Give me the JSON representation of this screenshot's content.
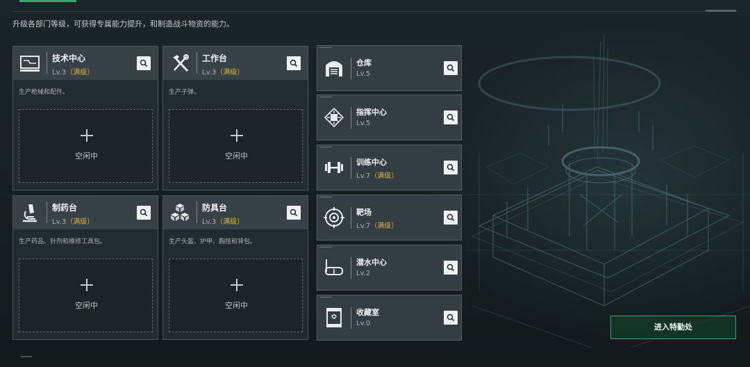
{
  "description": "升级各部门等级，可获得专属能力提升，和制造战斗物资的能力。",
  "cards": [
    {
      "name": "技术中心",
      "level": "Lv.3",
      "level_note": "（满级）",
      "subtitle": "生产枪械和配件。",
      "slot_label": "空闲中",
      "icon": "computer-icon"
    },
    {
      "name": "工作台",
      "level": "Lv.3",
      "level_note": "（满级）",
      "subtitle": "生产子弹。",
      "slot_label": "空闲中",
      "icon": "hammer-wrench-icon"
    },
    {
      "name": "制药台",
      "level": "Lv.3",
      "level_note": "（满级）",
      "subtitle": "生产药品、针剂和维修工具包。",
      "slot_label": "空闲中",
      "icon": "microscope-icon"
    },
    {
      "name": "防具台",
      "level": "Lv.3",
      "level_note": "（满级）",
      "subtitle": "生产头盔、护甲、胸挂和背包。",
      "slot_label": "空闲中",
      "icon": "armor-boxes-icon"
    }
  ],
  "rows": [
    {
      "name": "仓库",
      "level": "Lv.5",
      "level_note": "",
      "icon": "warehouse-icon"
    },
    {
      "name": "指挥中心",
      "level": "Lv.5",
      "level_note": "",
      "icon": "chip-icon"
    },
    {
      "name": "训练中心",
      "level": "Lv.7",
      "level_note": "（满级）",
      "icon": "dumbbell-icon"
    },
    {
      "name": "靶场",
      "level": "Lv.7",
      "level_note": "（满级）",
      "icon": "target-icon"
    },
    {
      "name": "潜水中心",
      "level": "Lv.2",
      "level_note": "",
      "icon": "diving-mask-icon"
    },
    {
      "name": "收藏室",
      "level": "Lv.0",
      "level_note": "",
      "icon": "display-case-icon"
    }
  ],
  "enter_button": "进入特勤处",
  "colors": {
    "accent_green": "#3fa46a",
    "max_level": "#d7b04a"
  }
}
